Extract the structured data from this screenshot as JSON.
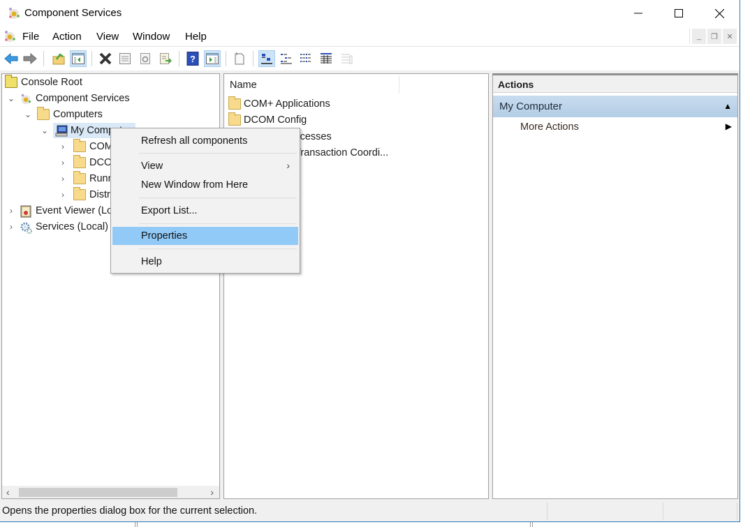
{
  "window": {
    "title": "Component Services",
    "icon": "component-services-icon",
    "controls": {
      "minimize": "—",
      "maximize": "☐",
      "close": "✕"
    }
  },
  "menubar": {
    "items": [
      "File",
      "Action",
      "View",
      "Window",
      "Help"
    ],
    "mdi_controls": {
      "minimize": "_",
      "restore": "❐",
      "close": "✕"
    }
  },
  "toolbar": {
    "buttons": [
      {
        "icon": "back-arrow-icon"
      },
      {
        "icon": "forward-arrow-icon"
      },
      {
        "icon": "up-one-level-icon"
      },
      {
        "icon": "show-hide-console-tree-icon",
        "active": true
      },
      {
        "icon": "delete-icon"
      },
      {
        "icon": "properties-icon"
      },
      {
        "icon": "refresh-icon"
      },
      {
        "icon": "export-list-icon"
      },
      {
        "icon": "help-icon"
      },
      {
        "icon": "show-hide-action-pane-icon",
        "active": true
      },
      {
        "icon": "new-object-icon"
      },
      {
        "icon": "large-icons-view-icon",
        "active": true
      },
      {
        "icon": "small-icons-view-icon"
      },
      {
        "icon": "list-view-icon"
      },
      {
        "icon": "detail-view-icon"
      },
      {
        "icon": "disabled-view-icon"
      }
    ]
  },
  "tree": {
    "items": [
      {
        "label": "Console Root",
        "level": 0,
        "icon": "folder-icon",
        "expander": ""
      },
      {
        "label": "Component Services",
        "level": 1,
        "icon": "component-services-icon",
        "expander": "⌄"
      },
      {
        "label": "Computers",
        "level": 2,
        "icon": "folder-icon",
        "expander": "⌄"
      },
      {
        "label": "My Computer",
        "level": 3,
        "icon": "computer-icon",
        "expander": "⌄",
        "selected": true
      },
      {
        "label": "COM+ Applications",
        "level": 4,
        "icon": "folder-icon",
        "expander": "›"
      },
      {
        "label": "DCOM Config",
        "level": 4,
        "icon": "folder-icon",
        "expander": "›"
      },
      {
        "label": "Running Processes",
        "level": 4,
        "icon": "folder-icon",
        "expander": "›"
      },
      {
        "label": "Distributed Transaction Coordinator",
        "level": 4,
        "icon": "folder-icon",
        "expander": "›"
      },
      {
        "label": "Event Viewer (Local)",
        "level": 1,
        "icon": "event-viewer-icon",
        "expander": "›"
      },
      {
        "label": "Services (Local)",
        "level": 1,
        "icon": "services-gear-icon",
        "expander": "›"
      }
    ]
  },
  "list": {
    "columns": [
      "Name"
    ],
    "items": [
      "COM+ Applications",
      "DCOM Config",
      "Running Processes",
      "Distributed Transaction Coordi..."
    ]
  },
  "actions": {
    "header": "Actions",
    "group": "My Computer",
    "items": [
      "More Actions"
    ]
  },
  "context_menu": {
    "items": [
      {
        "label": "Refresh all components"
      },
      {
        "label": "View",
        "submenu": "›"
      },
      {
        "label": "New Window from Here"
      },
      {
        "label": "Export List..."
      },
      {
        "label": "Properties",
        "highlighted": true
      },
      {
        "label": "Help"
      }
    ]
  },
  "status": {
    "text": "Opens the properties dialog box for the current selection."
  }
}
